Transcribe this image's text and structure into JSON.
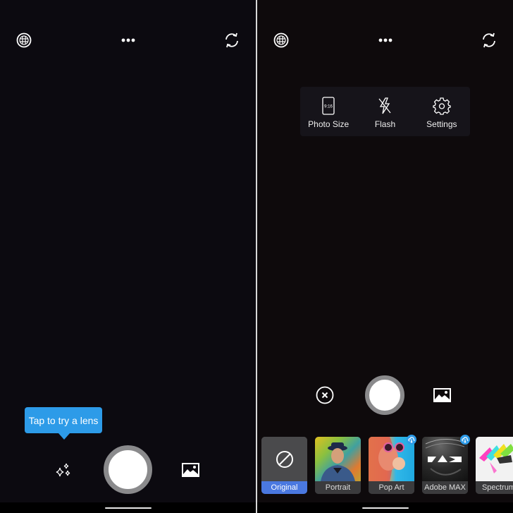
{
  "left_screen": {
    "top_bar": {
      "language_icon": "globe-icon",
      "more_icon": "more-horizontal-icon",
      "switch_camera_icon": "rotate-camera-icon"
    },
    "tooltip": {
      "text": "Tap to try a lens"
    },
    "bottom_bar": {
      "lens_icon": "sparkles-icon",
      "shutter": "shutter-button",
      "gallery_icon": "image-icon"
    }
  },
  "right_screen": {
    "top_bar": {
      "language_icon": "globe-icon",
      "more_icon": "more-horizontal-icon",
      "switch_camera_icon": "rotate-camera-icon"
    },
    "menu": {
      "items": [
        {
          "label": "Photo Size",
          "icon": "aspect-ratio-icon",
          "icon_text": "9:16"
        },
        {
          "label": "Flash",
          "icon": "flash-off-icon"
        },
        {
          "label": "Settings",
          "icon": "gear-icon"
        }
      ]
    },
    "bottom_bar": {
      "close_icon": "close-circle-icon",
      "shutter": "shutter-button",
      "gallery_icon": "image-icon"
    },
    "lenses": [
      {
        "label": "Original",
        "selected": true,
        "download": false
      },
      {
        "label": "Portrait",
        "selected": false,
        "download": false
      },
      {
        "label": "Pop Art",
        "selected": false,
        "download": true
      },
      {
        "label": "Adobe MAX",
        "selected": false,
        "download": true
      },
      {
        "label": "Spectrum",
        "selected": false,
        "download": false
      }
    ]
  },
  "colors": {
    "accent_blue": "#2d9be8",
    "selected_lens": "#4a78e0",
    "shutter_ring": "#8a8a8c"
  }
}
